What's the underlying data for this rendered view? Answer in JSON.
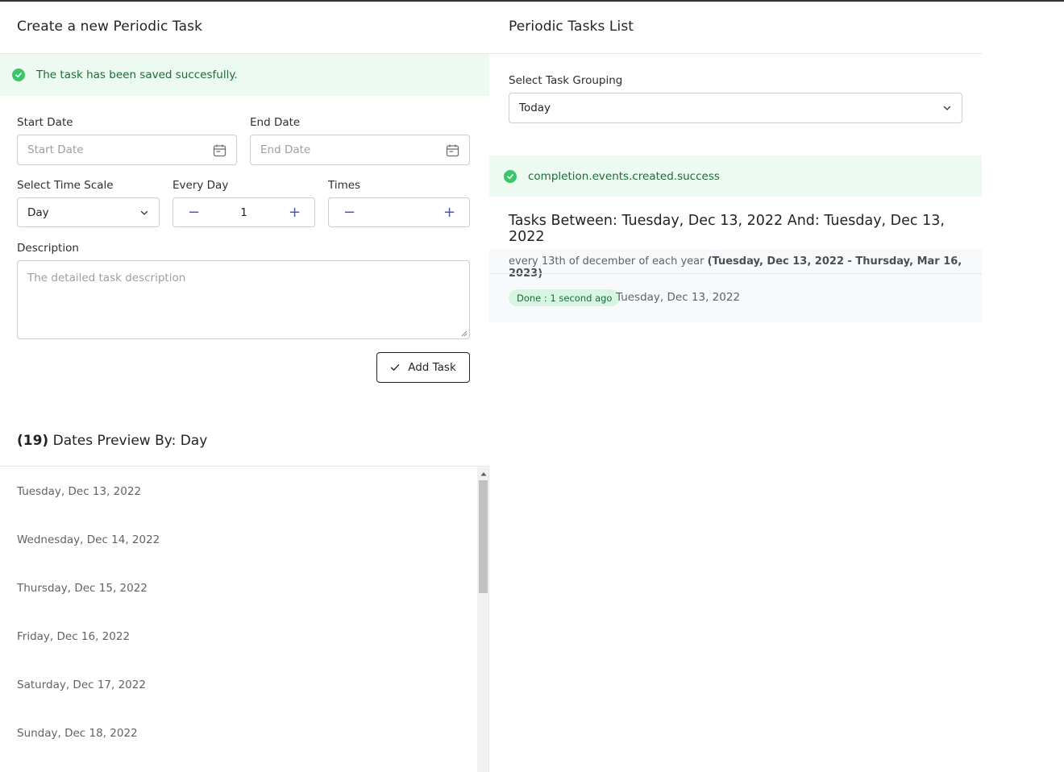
{
  "left": {
    "title": "Create a new Periodic Task",
    "alert": "The task has been saved succesfully.",
    "start_date": {
      "label": "Start Date",
      "placeholder": "Start Date"
    },
    "end_date": {
      "label": "End Date",
      "placeholder": "End Date"
    },
    "time_scale": {
      "label": "Select Time Scale",
      "value": "Day"
    },
    "every": {
      "label": "Every Day",
      "value": "1",
      "minus": "−",
      "plus": "+"
    },
    "times": {
      "label": "Times",
      "value": "",
      "minus": "−",
      "plus": "+"
    },
    "description": {
      "label": "Description",
      "placeholder": "The detailed task description"
    },
    "add_button": "Add Task",
    "preview": {
      "count": "(19)",
      "title": "Dates Preview By: Day",
      "dates": [
        "Tuesday, Dec 13, 2022",
        "Wednesday, Dec 14, 2022",
        "Thursday, Dec 15, 2022",
        "Friday, Dec 16, 2022",
        "Saturday, Dec 17, 2022",
        "Sunday, Dec 18, 2022"
      ]
    }
  },
  "right": {
    "title": "Periodic Tasks List",
    "grouping": {
      "label": "Select Task Grouping",
      "value": "Today"
    },
    "alert": "completion.events.created.success",
    "range_title": "Tasks Between: Tuesday, Dec 13, 2022 And: Tuesday, Dec 13, 2022",
    "task": {
      "description": "every 13th of december of each year",
      "span": "(Tuesday, Dec 13, 2022 - Thursday, Mar 16, 2023)",
      "badge": "Done : 1 second ago",
      "date": "Tuesday, Dec 13, 2022"
    }
  },
  "colors": {
    "accent": "#4b4fd8",
    "success_bg": "#ecfaf1",
    "success_icon": "#3ac569",
    "success_text": "#1e6b3a",
    "badge_bg": "#d7f5e1"
  }
}
